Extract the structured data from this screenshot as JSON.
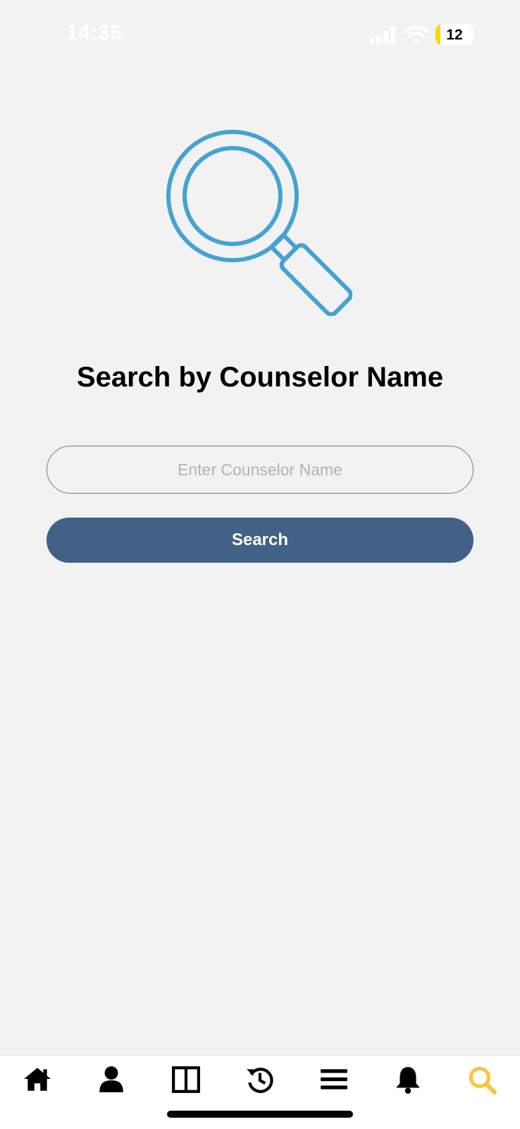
{
  "status_bar": {
    "time": "14:35",
    "battery_level": "12"
  },
  "main": {
    "title": "Search by Counselor Name",
    "search_placeholder": "Enter Counselor Name",
    "search_button_label": "Search",
    "icon": "magnifying-glass-icon"
  },
  "tab_bar": {
    "items": [
      {
        "icon": "home-icon"
      },
      {
        "icon": "person-icon"
      },
      {
        "icon": "columns-icon"
      },
      {
        "icon": "history-icon"
      },
      {
        "icon": "menu-icon"
      },
      {
        "icon": "bell-icon"
      },
      {
        "icon": "search-icon",
        "active": true
      }
    ]
  },
  "colors": {
    "background": "#f2f2f2",
    "accent_blue": "#45a2d3",
    "button": "#426186",
    "active_tab": "#f5c842"
  }
}
